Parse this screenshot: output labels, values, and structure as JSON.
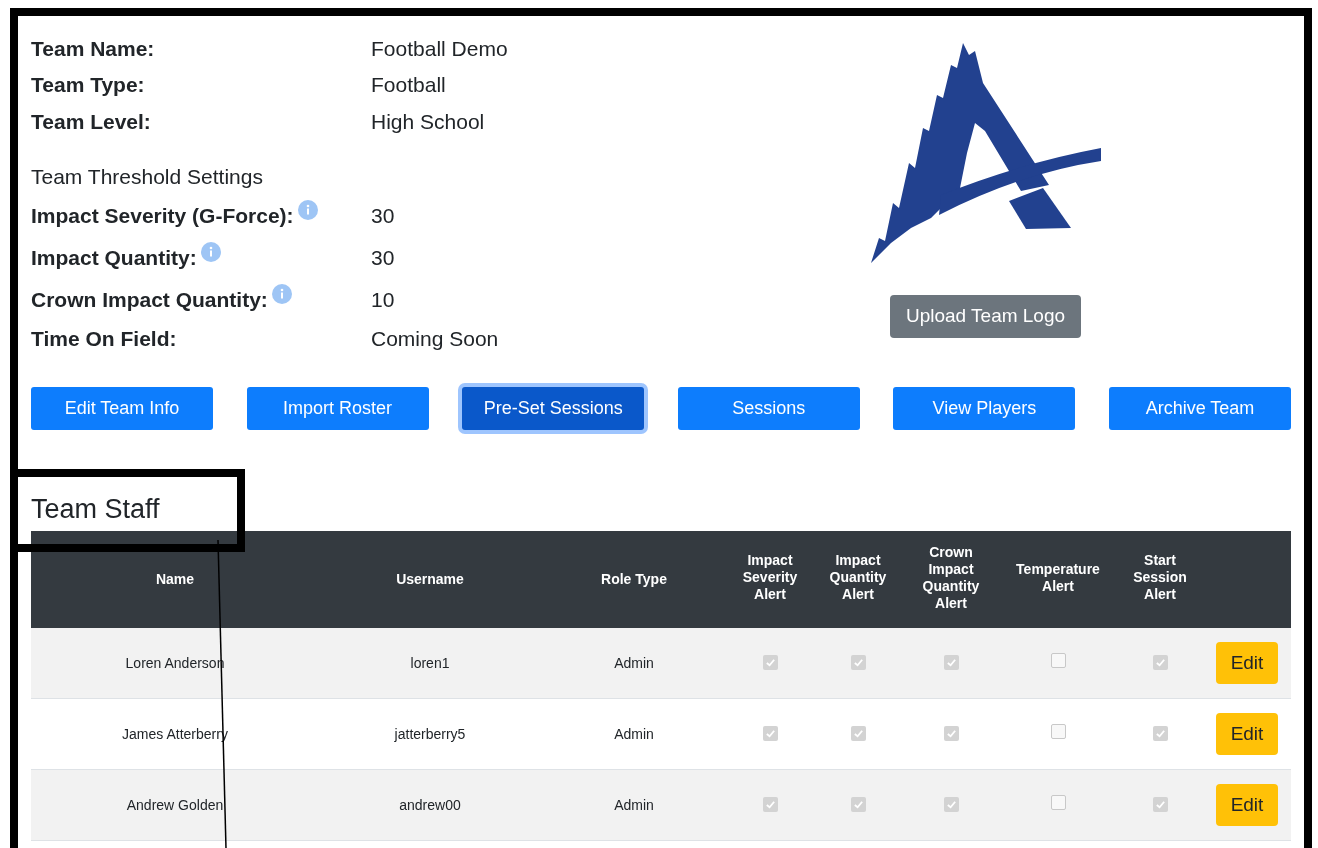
{
  "team_info": [
    {
      "label": "Team Name:",
      "value": "Football Demo"
    },
    {
      "label": "Team Type:",
      "value": "Football"
    },
    {
      "label": "Team Level:",
      "value": "High School"
    }
  ],
  "threshold_heading": "Team Threshold Settings",
  "thresholds": [
    {
      "label": "Impact Severity (G-Force):",
      "value": "30",
      "info": true
    },
    {
      "label": "Impact Quantity:",
      "value": "30",
      "info": true
    },
    {
      "label": "Crown Impact Quantity:",
      "value": "10",
      "info": true
    },
    {
      "label": "Time On Field:",
      "value": "Coming Soon",
      "info": false
    }
  ],
  "upload_button": "Upload Team Logo",
  "actions": [
    {
      "label": "Edit Team Info",
      "focused": false
    },
    {
      "label": "Import Roster",
      "focused": false
    },
    {
      "label": "Pre-Set Sessions",
      "focused": true
    },
    {
      "label": "Sessions",
      "focused": false
    },
    {
      "label": "View Players",
      "focused": false
    },
    {
      "label": "Archive Team",
      "focused": false
    }
  ],
  "staff_heading": "Team Staff",
  "table": {
    "columns": [
      "Name",
      "Username",
      "Role Type",
      "Impact Severity Alert",
      "Impact Quantity Alert",
      "Crown Impact Quantity Alert",
      "Temperature Alert",
      "Start Session Alert"
    ],
    "rows": [
      {
        "name": "Loren Anderson",
        "username": "loren1",
        "role": "Admin",
        "alerts": [
          {
            "checked": true,
            "disabled": true
          },
          {
            "checked": true,
            "disabled": true
          },
          {
            "checked": true,
            "disabled": true
          },
          {
            "checked": false,
            "disabled": true
          },
          {
            "checked": true,
            "disabled": true
          }
        ],
        "action": "Edit"
      },
      {
        "name": "James Atterberry",
        "username": "jatterberry5",
        "role": "Admin",
        "alerts": [
          {
            "checked": true,
            "disabled": true
          },
          {
            "checked": true,
            "disabled": true
          },
          {
            "checked": true,
            "disabled": true
          },
          {
            "checked": false,
            "disabled": true
          },
          {
            "checked": true,
            "disabled": true
          }
        ],
        "action": "Edit"
      },
      {
        "name": "Andrew Golden",
        "username": "andrew00",
        "role": "Admin",
        "alerts": [
          {
            "checked": true,
            "disabled": true
          },
          {
            "checked": true,
            "disabled": true
          },
          {
            "checked": true,
            "disabled": true
          },
          {
            "checked": false,
            "disabled": true
          },
          {
            "checked": true,
            "disabled": true
          }
        ],
        "action": "Edit"
      }
    ]
  }
}
